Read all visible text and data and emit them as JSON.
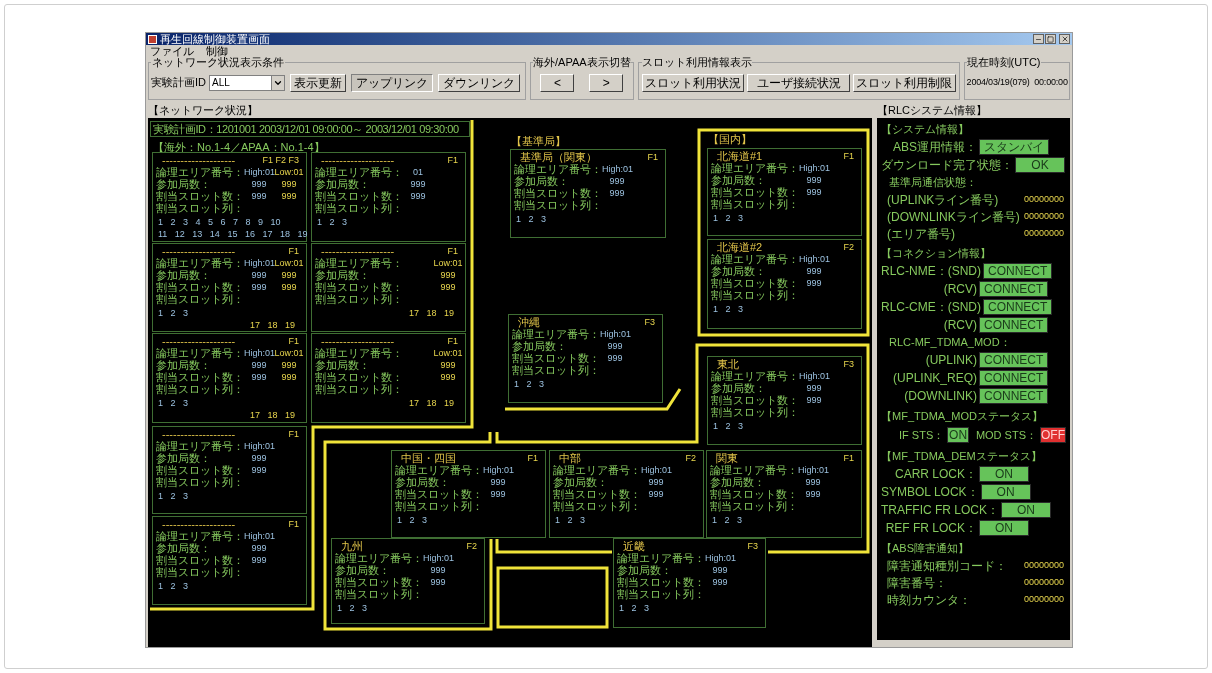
{
  "window": {
    "title": "再生回線制御装置画面"
  },
  "menu": [
    "ファイル",
    "制御"
  ],
  "toolbar": {
    "network_conditions": {
      "title": "ネットワーク状況表示条件",
      "plan_label": "実験計画ID",
      "plan_value": "ALL",
      "refresh": "表示更新",
      "links": [
        {
          "label": "アップリンク",
          "selected": true
        },
        {
          "label": "ダウンリンク",
          "selected": false
        }
      ]
    },
    "overseas_switch": {
      "title": "海外/APAA表示切替",
      "buttons": [
        "<",
        ">"
      ]
    },
    "slot_info": {
      "title": "スロット利用情報表示",
      "buttons": [
        "スロット利用状況",
        "ユーザ接続状況",
        "スロット利用制限"
      ]
    },
    "clock": {
      "title": "現在時刻(UTC)",
      "value": "2004/03/19(079)  00:00:00"
    }
  },
  "network": {
    "title": "【ネットワーク状況】",
    "plan_header": "実験計画ID：1201001 2003/12/01 09:00:00～ 2003/12/01 09:30:00",
    "overseas_label": "【海外：No.1-4／APAA：No.1-4】",
    "overseas": [
      {
        "title": "--------------------",
        "freq": "F1 F2 F3",
        "rows": [
          {
            "label": "論理エリア番号：",
            "high": "High:01",
            "low": "Low:01"
          },
          {
            "label": "参加局数：",
            "high": "999",
            "low": "999"
          },
          {
            "label": "割当スロット数：",
            "high": "999",
            "low": "999"
          },
          {
            "label": "割当スロット列："
          }
        ],
        "slots": [
          {
            "text": "1 2 3 4 5 6 7 8 9 10",
            "kind": "high"
          },
          {
            "text": "11 12 13 14 15 16 17 18 19",
            "kind": "high"
          }
        ]
      },
      {
        "title": "--------------------",
        "freq": "F1",
        "rows": [
          {
            "label": "論理エリア番号：",
            "high": "01"
          },
          {
            "label": "参加局数：",
            "high": "999"
          },
          {
            "label": "割当スロット数：",
            "high": "999"
          },
          {
            "label": "割当スロット列："
          }
        ],
        "slots": [
          {
            "text": "1 2 3",
            "kind": "high"
          }
        ]
      },
      {
        "title": "--------------------",
        "freq": "F1",
        "rows": [
          {
            "label": "論理エリア番号：",
            "high": "High:01",
            "low": "Low:01"
          },
          {
            "label": "参加局数：",
            "high": "999",
            "low": "999"
          },
          {
            "label": "割当スロット数：",
            "high": "999",
            "low": "999"
          },
          {
            "label": "割当スロット列："
          }
        ],
        "slots": [
          {
            "text": "1 2 3",
            "kind": "high"
          },
          {
            "text": "17 18 19",
            "kind": "low"
          }
        ]
      },
      {
        "title": "--------------------",
        "freq": "F1",
        "rows": [
          {
            "label": "論理エリア番号：",
            "low": "Low:01"
          },
          {
            "label": "参加局数：",
            "low": "999"
          },
          {
            "label": "割当スロット数：",
            "low": "999"
          },
          {
            "label": "割当スロット列："
          }
        ],
        "slots": [
          {
            "text": "17 18 19",
            "kind": "low"
          }
        ]
      },
      {
        "title": "--------------------",
        "freq": "F1",
        "rows": [
          {
            "label": "論理エリア番号：",
            "high": "High:01",
            "low": "Low:01"
          },
          {
            "label": "参加局数：",
            "high": "999",
            "low": "999"
          },
          {
            "label": "割当スロット数：",
            "high": "999",
            "low": "999"
          },
          {
            "label": "割当スロット列："
          }
        ],
        "slots": [
          {
            "text": "1 2 3",
            "kind": "high"
          },
          {
            "text": "17 18 19",
            "kind": "low"
          }
        ]
      },
      {
        "title": "--------------------",
        "freq": "F1",
        "rows": [
          {
            "label": "論理エリア番号：",
            "low": "Low:01"
          },
          {
            "label": "参加局数：",
            "low": "999"
          },
          {
            "label": "割当スロット数：",
            "low": "999"
          },
          {
            "label": "割当スロット列："
          }
        ],
        "slots": [
          {
            "text": "17 18 19",
            "kind": "low"
          }
        ]
      },
      {
        "title": "--------------------",
        "freq": "F1",
        "rows": [
          {
            "label": "論理エリア番号：",
            "high": "High:01"
          },
          {
            "label": "参加局数：",
            "high": "999"
          },
          {
            "label": "割当スロット数：",
            "high": "999"
          },
          {
            "label": "割当スロット列："
          }
        ],
        "slots": [
          {
            "text": "1 2 3",
            "kind": "high"
          }
        ]
      },
      {
        "title": "--------------------",
        "freq": "F1",
        "rows": [
          {
            "label": "論理エリア番号：",
            "high": "High:01"
          },
          {
            "label": "参加局数：",
            "high": "999"
          },
          {
            "label": "割当スロット数：",
            "high": "999"
          },
          {
            "label": "割当スロット列："
          }
        ],
        "slots": [
          {
            "text": "1 2 3",
            "kind": "high"
          }
        ]
      }
    ],
    "group_labels": [
      "【基準局】",
      "【国内】"
    ],
    "domestic": [
      {
        "title": "基準局（関東）",
        "freq": "F1",
        "rows": [
          {
            "label": "論理エリア番号：",
            "high": "High:01"
          },
          {
            "label": "参加局数：",
            "high": "999"
          },
          {
            "label": "割当スロット数：",
            "high": "999"
          },
          {
            "label": "割当スロット列："
          }
        ],
        "slots": [
          {
            "text": "1 2 3",
            "kind": "high"
          }
        ]
      },
      {
        "title": "北海道#1",
        "freq": "F1",
        "rows": [
          {
            "label": "論理エリア番号：",
            "high": "High:01"
          },
          {
            "label": "参加局数：",
            "high": "999"
          },
          {
            "label": "割当スロット数：",
            "high": "999"
          },
          {
            "label": "割当スロット列："
          }
        ],
        "slots": [
          {
            "text": "1 2 3",
            "kind": "high"
          }
        ]
      },
      {
        "title": "北海道#2",
        "freq": "F2",
        "rows": [
          {
            "label": "論理エリア番号：",
            "high": "High:01"
          },
          {
            "label": "参加局数：",
            "high": "999"
          },
          {
            "label": "割当スロット数：",
            "high": "999"
          },
          {
            "label": "割当スロット列："
          }
        ],
        "slots": [
          {
            "text": "1 2 3",
            "kind": "high"
          }
        ]
      },
      {
        "title": "沖縄",
        "freq": "F3",
        "rows": [
          {
            "label": "論理エリア番号：",
            "high": "High:01"
          },
          {
            "label": "参加局数：",
            "high": "999"
          },
          {
            "label": "割当スロット数：",
            "high": "999"
          },
          {
            "label": "割当スロット列："
          }
        ],
        "slots": [
          {
            "text": "1 2 3",
            "kind": "high"
          }
        ]
      },
      {
        "title": "東北",
        "freq": "F3",
        "rows": [
          {
            "label": "論理エリア番号：",
            "high": "High:01"
          },
          {
            "label": "参加局数：",
            "high": "999"
          },
          {
            "label": "割当スロット数：",
            "high": "999"
          },
          {
            "label": "割当スロット列："
          }
        ],
        "slots": [
          {
            "text": "1 2 3",
            "kind": "high"
          }
        ]
      },
      {
        "title": "中国・四国",
        "freq": "F1",
        "rows": [
          {
            "label": "論理エリア番号：",
            "high": "High:01"
          },
          {
            "label": "参加局数：",
            "high": "999"
          },
          {
            "label": "割当スロット数：",
            "high": "999"
          },
          {
            "label": "割当スロット列："
          }
        ],
        "slots": [
          {
            "text": "1 2 3",
            "kind": "high"
          }
        ]
      },
      {
        "title": "中部",
        "freq": "F2",
        "rows": [
          {
            "label": "論理エリア番号：",
            "high": "High:01"
          },
          {
            "label": "参加局数：",
            "high": "999"
          },
          {
            "label": "割当スロット数：",
            "high": "999"
          },
          {
            "label": "割当スロット列："
          }
        ],
        "slots": [
          {
            "text": "1 2 3",
            "kind": "high"
          }
        ]
      },
      {
        "title": "関東",
        "freq": "F1",
        "rows": [
          {
            "label": "論理エリア番号：",
            "high": "High:01"
          },
          {
            "label": "参加局数：",
            "high": "999"
          },
          {
            "label": "割当スロット数：",
            "high": "999"
          },
          {
            "label": "割当スロット列："
          }
        ],
        "slots": [
          {
            "text": "1 2 3",
            "kind": "high"
          }
        ]
      },
      {
        "title": "九州",
        "freq": "F2",
        "rows": [
          {
            "label": "論理エリア番号：",
            "high": "High:01"
          },
          {
            "label": "参加局数：",
            "high": "999"
          },
          {
            "label": "割当スロット数：",
            "high": "999"
          },
          {
            "label": "割当スロット列："
          }
        ],
        "slots": [
          {
            "text": "1 2 3",
            "kind": "high"
          }
        ]
      },
      {
        "title": "近畿",
        "freq": "F3",
        "rows": [
          {
            "label": "論理エリア番号：",
            "high": "High:01"
          },
          {
            "label": "参加局数：",
            "high": "999"
          },
          {
            "label": "割当スロット数：",
            "high": "999"
          },
          {
            "label": "割当スロット列："
          }
        ],
        "slots": [
          {
            "text": "1 2 3",
            "kind": "high"
          }
        ]
      }
    ]
  },
  "rlc": {
    "title": "【RLCシステム情報】",
    "sections": [
      {
        "heading": "【システム情報】",
        "items": [
          {
            "kind": "indicator",
            "label": "ABS運用情報：",
            "value": "スタンバイ",
            "on": true
          },
          {
            "kind": "indicator",
            "label": "ダウンロード完了状態：",
            "value": "OK",
            "on": true
          },
          {
            "kind": "text",
            "label": "基準局通信状態："
          },
          {
            "kind": "reading",
            "label": "(UPLINKライン番号)",
            "value": "00000000"
          },
          {
            "kind": "reading",
            "label": "(DOWNLINKライン番号)",
            "value": "00000000"
          },
          {
            "kind": "reading",
            "label": "(エリア番号)",
            "value": "00000000"
          }
        ]
      },
      {
        "heading": "【コネクション情報】",
        "items": [
          {
            "kind": "indicator",
            "label": "RLC-NME：(SND)",
            "value": "CONNECT",
            "on": true
          },
          {
            "kind": "indicator",
            "label": "(RCV)",
            "value": "CONNECT",
            "on": true
          },
          {
            "kind": "indicator",
            "label": "RLC-CME：(SND)",
            "value": "CONNECT",
            "on": true
          },
          {
            "kind": "indicator",
            "label": "(RCV)",
            "value": "CONNECT",
            "on": true
          },
          {
            "kind": "text",
            "label": "RLC-MF_TDMA_MOD："
          },
          {
            "kind": "indicator",
            "label": "(UPLINK)",
            "value": "CONNECT",
            "on": true
          },
          {
            "kind": "indicator",
            "label": "(UPLINK_REQ)",
            "value": "CONNECT",
            "on": true
          },
          {
            "kind": "indicator",
            "label": "(DOWNLINK)",
            "value": "CONNECT",
            "on": true
          }
        ]
      },
      {
        "heading": "【MF_TDMA_MODステータス】",
        "items": [
          {
            "kind": "pair",
            "indicators": [
              {
                "label": "IF STS：",
                "value": "ON",
                "on": true
              },
              {
                "label": "MOD STS：",
                "value": "OFF",
                "on": false
              }
            ]
          }
        ]
      },
      {
        "heading": "【MF_TDMA_DEMステータス】",
        "items": [
          {
            "kind": "indicator",
            "label": "CARR LOCK：",
            "value": "ON",
            "on": true
          },
          {
            "kind": "indicator",
            "label": "SYMBOL LOCK：",
            "value": "ON",
            "on": true
          },
          {
            "kind": "indicator",
            "label": "TRAFFIC FR LOCK：",
            "value": "ON",
            "on": true
          },
          {
            "kind": "indicator",
            "label": "REF FR LOCK：",
            "value": "ON",
            "on": true
          }
        ]
      },
      {
        "heading": "【ABS障害通知】",
        "items": [
          {
            "kind": "reading",
            "label": "障害通知種別コード：",
            "value": "00000000"
          },
          {
            "kind": "reading",
            "label": "障害番号：",
            "value": "00000000"
          },
          {
            "kind": "reading",
            "label": "時刻カウンタ：",
            "value": "00000000"
          }
        ]
      }
    ]
  }
}
